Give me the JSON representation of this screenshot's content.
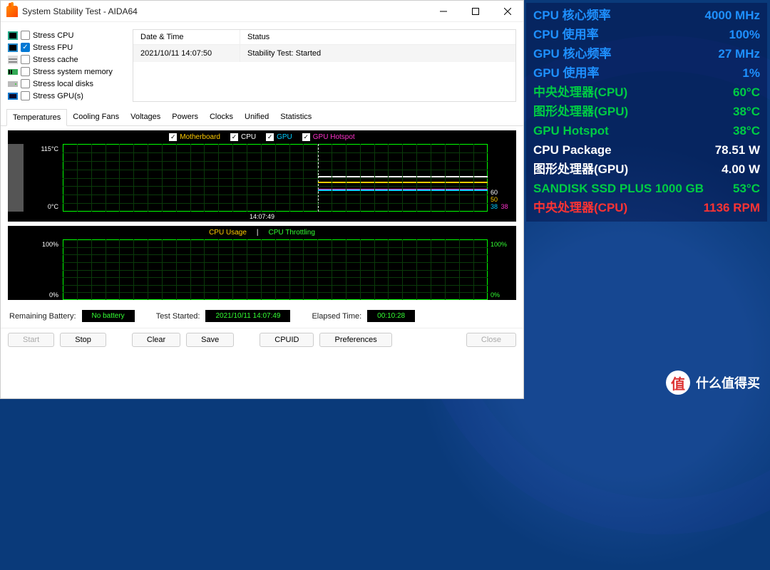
{
  "window": {
    "title": "System Stability Test - AIDA64"
  },
  "stress": [
    {
      "label": "Stress CPU",
      "checked": false,
      "iconColor": "#2a8"
    },
    {
      "label": "Stress FPU",
      "checked": true,
      "iconColor": "#28c"
    },
    {
      "label": "Stress cache",
      "checked": false,
      "iconColor": "#888"
    },
    {
      "label": "Stress system memory",
      "checked": false,
      "iconColor": "#555"
    },
    {
      "label": "Stress local disks",
      "checked": false,
      "iconColor": "#777"
    },
    {
      "label": "Stress GPU(s)",
      "checked": false,
      "iconColor": "#17c"
    }
  ],
  "log": {
    "headers": {
      "dt": "Date & Time",
      "status": "Status"
    },
    "row": {
      "dt": "2021/10/11 14:07:50",
      "status": "Stability Test: Started"
    }
  },
  "tabs": [
    "Temperatures",
    "Cooling Fans",
    "Voltages",
    "Powers",
    "Clocks",
    "Unified",
    "Statistics"
  ],
  "chart1": {
    "legend": [
      {
        "label": "Motherboard",
        "color": "#ffcc00"
      },
      {
        "label": "CPU",
        "color": "#ffffff"
      },
      {
        "label": "GPU",
        "color": "#00ccff"
      },
      {
        "label": "GPU Hotspot",
        "color": "#ff33cc"
      }
    ],
    "ymax": "115°C",
    "ymin": "0°C",
    "marker_x": "14:07:49",
    "end_values": {
      "cpu": "60",
      "mb": "50",
      "gpu": "38",
      "hot": "38"
    }
  },
  "chart2": {
    "legend": [
      {
        "label": "CPU Usage",
        "color": "#ffcc00"
      },
      {
        "label": "CPU Throttling",
        "color": "#33ff33"
      }
    ],
    "ymax": "100%",
    "ymin": "0%"
  },
  "status": {
    "battLabel": "Remaining Battery:",
    "batt": "No battery",
    "startLabel": "Test Started:",
    "start": "2021/10/11 14:07:49",
    "elapsedLabel": "Elapsed Time:",
    "elapsed": "00:10:28"
  },
  "buttons": {
    "start": "Start",
    "stop": "Stop",
    "clear": "Clear",
    "save": "Save",
    "cpuid": "CPUID",
    "prefs": "Preferences",
    "close": "Close"
  },
  "overlay": [
    {
      "label": "CPU 核心频率",
      "value": "4000 MHz",
      "color": "#1e90ff"
    },
    {
      "label": "CPU 使用率",
      "value": "100%",
      "color": "#1e90ff"
    },
    {
      "label": "GPU 核心频率",
      "value": "27 MHz",
      "color": "#1e90ff"
    },
    {
      "label": "GPU 使用率",
      "value": "1%",
      "color": "#1e90ff"
    },
    {
      "label": "中央处理器(CPU)",
      "value": "60°C",
      "color": "#00cc44"
    },
    {
      "label": "图形处理器(GPU)",
      "value": "38°C",
      "color": "#00cc44"
    },
    {
      "label": "GPU Hotspot",
      "value": "38°C",
      "color": "#00cc44"
    },
    {
      "label": "CPU Package",
      "value": "78.51 W",
      "color": "#ffffff"
    },
    {
      "label": "图形处理器(GPU)",
      "value": "4.00 W",
      "color": "#ffffff"
    },
    {
      "label": "SANDISK SSD PLUS 1000 GB",
      "value": "53°C",
      "color": "#00cc44"
    },
    {
      "label": "中央处理器(CPU)",
      "value": "1136 RPM",
      "color": "#ff3333"
    }
  ],
  "watermark": {
    "icon": "值",
    "text": "什么值得买"
  },
  "chart_data": [
    {
      "type": "line",
      "title": "Temperatures",
      "ylabel": "°C",
      "ylim": [
        0,
        115
      ],
      "x_marker": "14:07:49",
      "series": [
        {
          "name": "Motherboard",
          "end_value": 50
        },
        {
          "name": "CPU",
          "end_value": 60
        },
        {
          "name": "GPU",
          "end_value": 38
        },
        {
          "name": "GPU Hotspot",
          "end_value": 38
        }
      ]
    },
    {
      "type": "line",
      "title": "CPU Usage / Throttling",
      "ylabel": "%",
      "ylim": [
        0,
        100
      ],
      "series": [
        {
          "name": "CPU Usage",
          "end_value": 0
        },
        {
          "name": "CPU Throttling",
          "end_value": 0
        }
      ]
    }
  ]
}
